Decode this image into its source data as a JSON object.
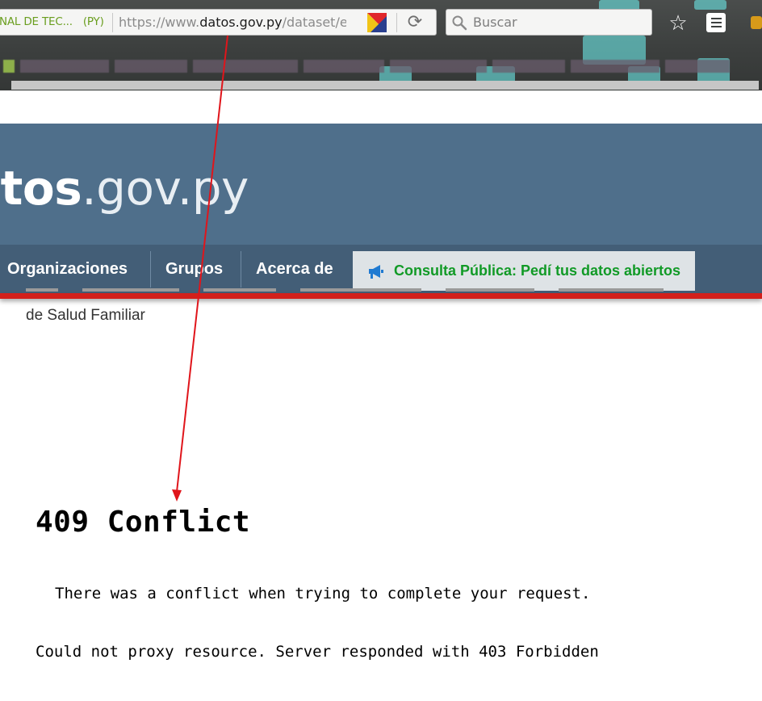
{
  "browser": {
    "identity_label": "NAL DE TEC...",
    "identity_country": "(PY)",
    "url_prefix": "https://www.",
    "url_host": "datos.gov.py",
    "url_path": "/dataset/e",
    "search_placeholder": "Buscar",
    "colors": {
      "identity_green": "#6a9e1f",
      "chrome_bg": "#3c3f3e"
    },
    "icons": [
      "reload-icon",
      "search-icon",
      "bookmark-star-icon",
      "reader-list-icon"
    ]
  },
  "site": {
    "logo_strong": "atos",
    "logo_light": ".gov.py",
    "nav": [
      {
        "label": "Organizaciones"
      },
      {
        "label": "Grupos"
      },
      {
        "label": "Acerca de"
      }
    ],
    "consulta_label": "Consulta Pública: Pedí tus datos abiertos",
    "colors": {
      "header": "#4f6f8b",
      "nav": "#435e77",
      "accent_red": "#d2201b",
      "consulta_green": "#119a26"
    }
  },
  "content": {
    "partial_line": "de Salud Familiar"
  },
  "error": {
    "title": "409 Conflict",
    "description": "There was a conflict when trying to complete your request.",
    "detail": "Could not proxy resource. Server responded with 403 Forbidden"
  },
  "annotation": {
    "color": "#e0151b"
  }
}
